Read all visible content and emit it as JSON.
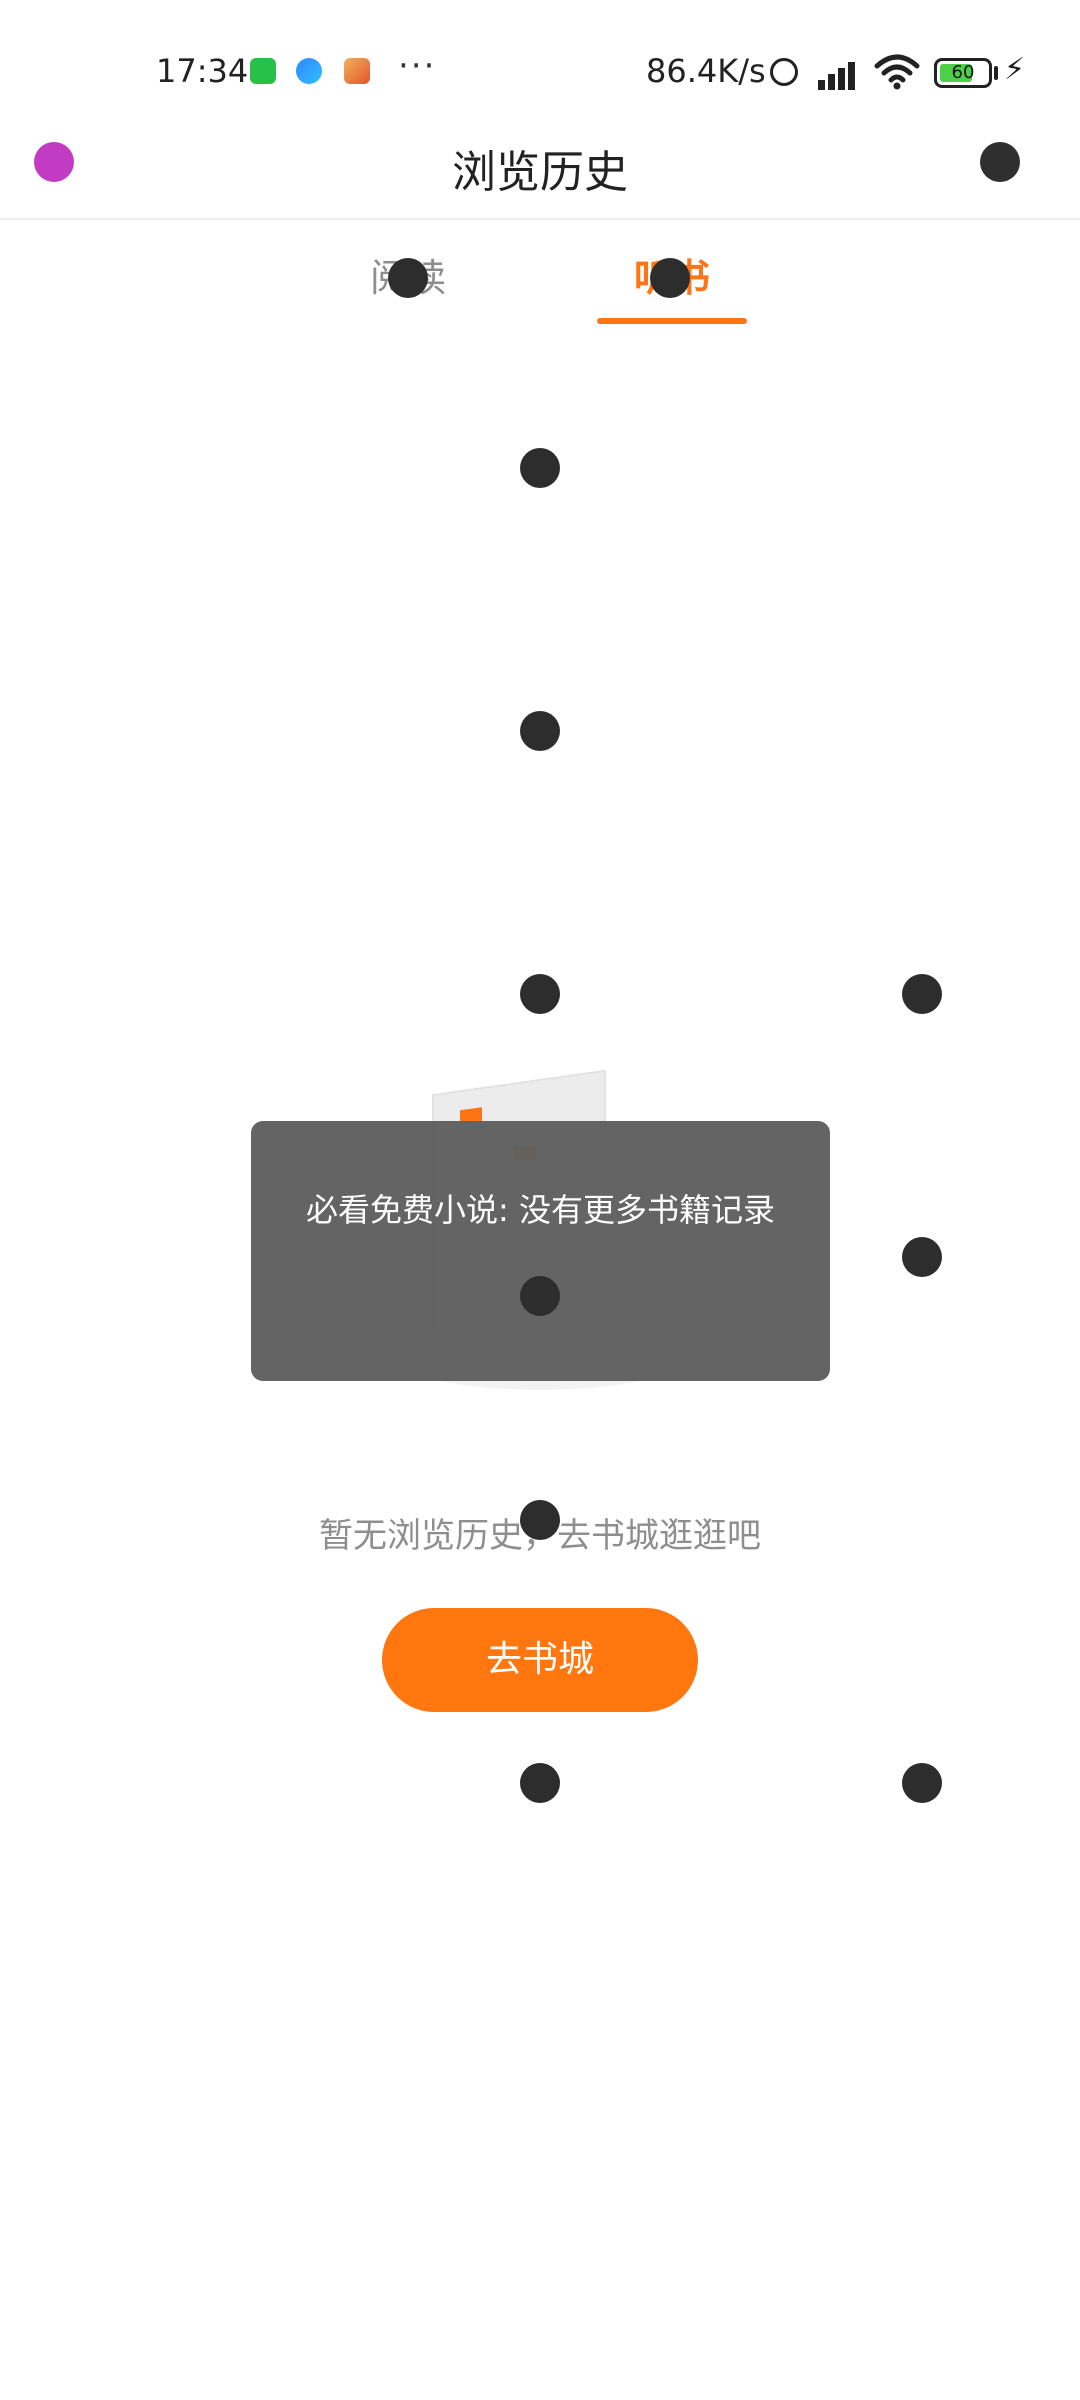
{
  "status_bar": {
    "time": "17:34",
    "more": "···",
    "net_speed": "86.4K/s",
    "battery": "60",
    "charging_icon": "lightning-icon"
  },
  "header": {
    "title": "浏览历史",
    "back_icon": "back-icon",
    "trash_icon": "trash-icon"
  },
  "tabs": {
    "items": [
      {
        "label": "阅读",
        "active": false
      },
      {
        "label": "听书",
        "active": true
      }
    ],
    "accent_color": "#ff7414"
  },
  "empty_state": {
    "message": "暂无浏览历史，去书城逛逛吧",
    "button_label": "去书城",
    "button_color": "#ff770e",
    "illustration_icon": "book-stack-icon"
  },
  "toast": {
    "text": "必看免费小说: 没有更多书籍记录"
  }
}
